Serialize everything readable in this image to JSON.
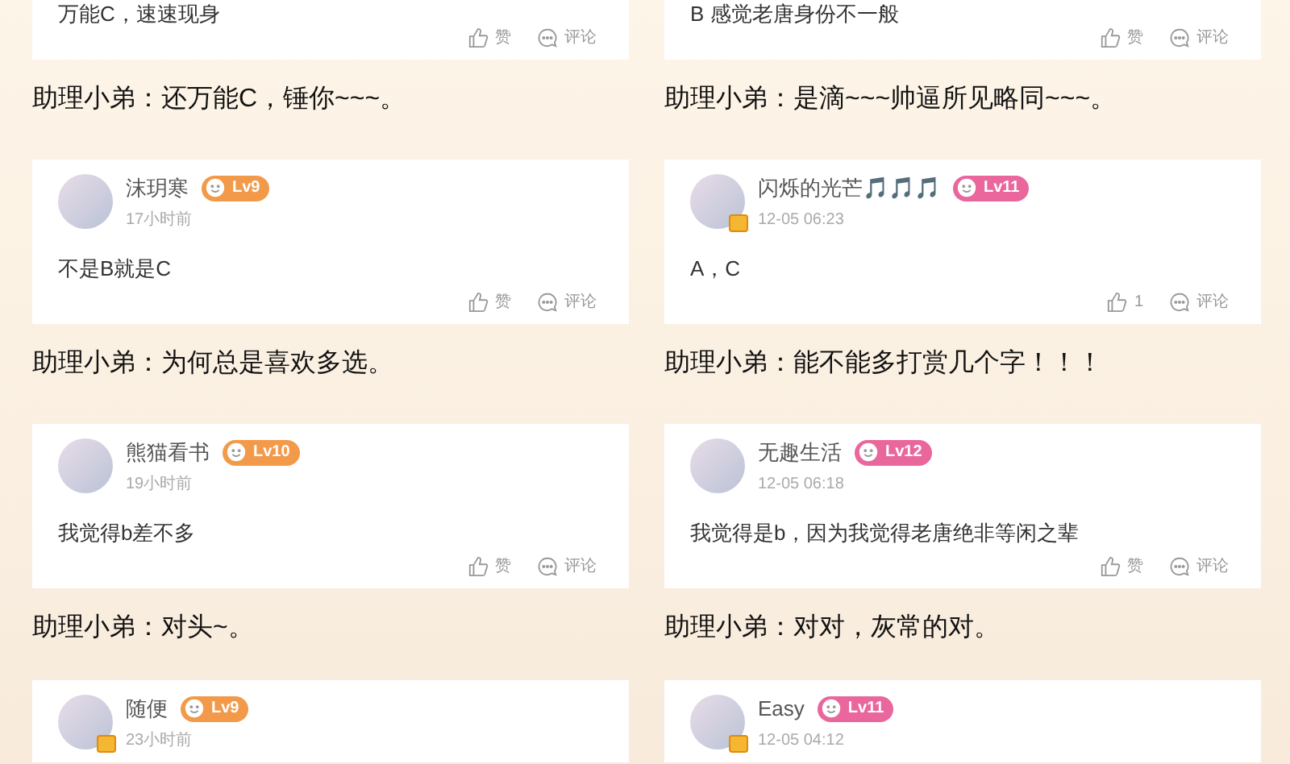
{
  "columns": [
    {
      "items": [
        {
          "kind": "card",
          "content": "万能C，速速现身",
          "like": "赞",
          "comment": "评论"
        },
        {
          "kind": "reply",
          "text": "助理小弟：还万能C，锤你~~~。"
        },
        {
          "kind": "card",
          "user": {
            "name": "沫玥寒",
            "time": "17小时前",
            "level_badge": {
              "kind": "cat",
              "text": "Lv9"
            },
            "vip": false
          },
          "content": "不是B就是C",
          "like": "赞",
          "comment": "评论"
        },
        {
          "kind": "reply",
          "text": "助理小弟：为何总是喜欢多选。"
        },
        {
          "kind": "card",
          "user": {
            "name": "熊猫看书",
            "time": "19小时前",
            "level_badge": {
              "kind": "cat",
              "text": "Lv10"
            },
            "vip": false
          },
          "content": "我觉得b差不多",
          "like": "赞",
          "comment": "评论"
        },
        {
          "kind": "reply",
          "text": "助理小弟：对头~。"
        },
        {
          "kind": "card",
          "user": {
            "name": "随便",
            "time": "23小时前",
            "level_badge": {
              "kind": "cat",
              "text": "Lv9"
            },
            "vip": true
          }
        }
      ]
    },
    {
      "items": [
        {
          "kind": "card",
          "content": "B 感觉老唐身份不一般",
          "like": "赞",
          "comment": "评论"
        },
        {
          "kind": "reply",
          "text": "助理小弟：是滴~~~帅逼所见略同~~~。"
        },
        {
          "kind": "card",
          "user": {
            "name": "闪烁的光芒🎵🎵🎵",
            "time": "12-05 06:23",
            "level_badge": {
              "kind": "apple",
              "text": "Lv11"
            },
            "vip": true
          },
          "content": "A，C",
          "like": "1",
          "comment": "评论"
        },
        {
          "kind": "reply",
          "text": "助理小弟：能不能多打赏几个字！！！"
        },
        {
          "kind": "card",
          "user": {
            "name": "无趣生活",
            "time": "12-05 06:18",
            "level_badge": {
              "kind": "apple",
              "text": "Lv12"
            },
            "vip": false
          },
          "content": "我觉得是b，因为我觉得老唐绝非等闲之辈",
          "like": "赞",
          "comment": "评论"
        },
        {
          "kind": "reply",
          "text": "助理小弟：对对，灰常的对。"
        },
        {
          "kind": "card",
          "user": {
            "name": "Easy",
            "time": "12-05 04:12",
            "level_badge": {
              "kind": "apple",
              "text": "Lv11"
            },
            "vip": true
          }
        }
      ]
    }
  ]
}
